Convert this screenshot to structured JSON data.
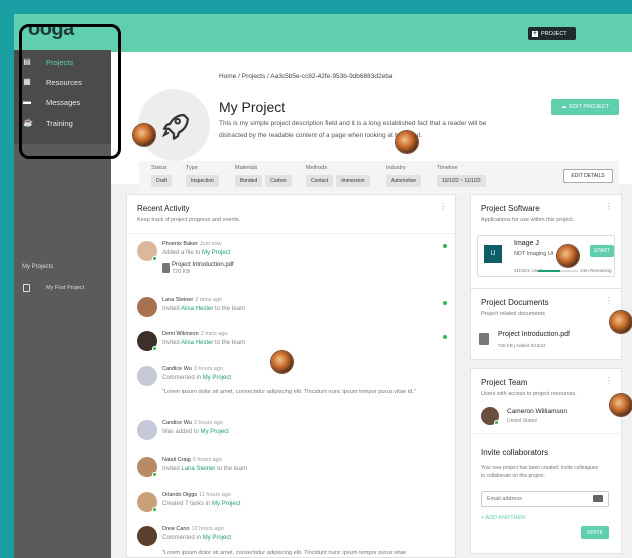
{
  "brand": {
    "logo": "ooga"
  },
  "sidebar": {
    "items": [
      {
        "label": "Projects",
        "icon": "file-icon",
        "active": true
      },
      {
        "label": "Resources",
        "icon": "grid-icon"
      },
      {
        "label": "Messages",
        "icon": "chat-icon"
      },
      {
        "label": "Training",
        "icon": "training-icon"
      }
    ],
    "section_label": "My Projects",
    "projects": [
      {
        "label": "My First Project"
      }
    ]
  },
  "topbar": {
    "new_project_label": "PROJECT"
  },
  "header": {
    "breadcrumb": "Home  /  Projects  /  Aa3c5b5e-cc82-42fe-953b-9db6883d2eba",
    "title": "My Project",
    "description": "This is my simple project description field and it is a long established fact that a reader will be distracted by the readable content of a page when looking at its layout.",
    "edit_label": "EDIT PROJECT",
    "edit_details_label": "EDIT DETAILS",
    "meta": {
      "status": {
        "label": "Status",
        "chips": [
          "Draft"
        ]
      },
      "type": {
        "label": "Type",
        "chips": [
          "Inspection"
        ]
      },
      "materials": {
        "label": "Materials",
        "chips": [
          "Bonded",
          "Carbon"
        ]
      },
      "methods": {
        "label": "Methods",
        "chips": [
          "Contact",
          "Immersion"
        ]
      },
      "industry": {
        "label": "Industry",
        "chips": [
          "Automotive"
        ]
      },
      "timeline": {
        "label": "Timeline",
        "chips": [
          "10/1/22 ~ 11/1/22"
        ]
      }
    }
  },
  "activity": {
    "title": "Recent Activity",
    "subtitle": "Keep track of project progress and events.",
    "items": [
      {
        "name": "Phoenix Baker",
        "time": "Just now",
        "action": "Added a file to",
        "link": "My Project",
        "file": "Project Introduction.pdf",
        "file_size": "720 KB"
      },
      {
        "name": "Lana Steiner",
        "time": "2 mins ago",
        "action": "Invited",
        "link": "Alisa Hester",
        "suffix": "to the team"
      },
      {
        "name": "Demi Wikinson",
        "time": "2 mins ago",
        "action": "Invited",
        "link": "Alisa Hester",
        "suffix": "to the team"
      },
      {
        "name": "Candice Wu",
        "time": "3 hours ago",
        "action": "Commented in",
        "link": "My Project",
        "excerpt": "\"Lorem ipsum dolor sit amet, consectetur adipiscing elit. Tincidunt nunc ipsum tempor purus vitae id.\""
      },
      {
        "name": "Candice Wu",
        "time": "3 hours ago",
        "action": "Was added to",
        "link": "My Project"
      },
      {
        "name": "Natali Craig",
        "time": "6 hours ago",
        "action": "Invited",
        "link": "Lana Steiner",
        "suffix": "to the team"
      },
      {
        "name": "Orlando Diggs",
        "time": "11 hours ago",
        "action": "Created 7 tasks in",
        "link": "My Project"
      },
      {
        "name": "Drew Cano",
        "time": "12 hours ago",
        "action": "Commented in",
        "link": "My Project",
        "excerpt": "\"Lorem ipsum dolor sit amet, consectetur adipiscing elit. Tincidunt nunc ipsum tempor purus vitae"
      }
    ]
  },
  "software": {
    "title": "Project Software",
    "subtitle": "Applications for use within this project.",
    "app": {
      "icon_text": "IJ",
      "name": "Image J",
      "desc": "NDT Imaging Ut",
      "start_label": "START",
      "used": "31h34m Used",
      "remaining": "14m Remaining",
      "used_fraction": 0.55
    }
  },
  "documents": {
    "title": "Project Documents",
    "subtitle": "Project related documents",
    "doc": {
      "name": "Project Introduction.pdf",
      "meta": "720 KB  |  Added 9/16/22"
    }
  },
  "team": {
    "title": "Project Team",
    "subtitle": "Users with access to project resources.",
    "member": {
      "name": "Cameron Williamson",
      "location": "United States"
    },
    "invite_title": "Invite collaborators",
    "invite_desc": "Your new project has been created. Invite colleagues to collaborate on this project.",
    "email_placeholder": "Email address",
    "add_another": "+ ADD ANOTHER",
    "invite_label": "INVITE"
  },
  "colors": {
    "accent": "#5fcfae",
    "link": "#1e9d74",
    "sidebar": "#5b5b5b",
    "background": "#1a9ea3"
  }
}
